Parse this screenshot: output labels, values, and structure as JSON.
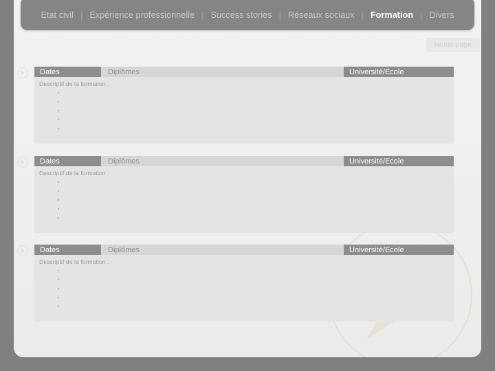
{
  "nav": {
    "separator": "|",
    "items": [
      {
        "label": "Etat civil",
        "active": false
      },
      {
        "label": "Expérience professionnelle",
        "active": false
      },
      {
        "label": "Success stories",
        "active": false
      },
      {
        "label": "Réseaux sociaux",
        "active": false
      },
      {
        "label": "Formation",
        "active": true
      },
      {
        "label": "Divers",
        "active": false
      }
    ]
  },
  "home_button": {
    "label": "Home page"
  },
  "columns": {
    "dates": "Dates",
    "diplomas": "Diplômes",
    "university": "Université/Ecole"
  },
  "description_label": "Descriptif de la formation :",
  "blocks": [
    {
      "dates": "Dates",
      "diplomas": "Diplômes",
      "university": "Université/Ecole",
      "description_label": "Descriptif de la formation :",
      "bullets": [
        "",
        "",
        "",
        "",
        ""
      ]
    },
    {
      "dates": "Dates",
      "diplomas": "Diplômes",
      "university": "Université/Ecole",
      "description_label": "Descriptif de la formation :",
      "bullets": [
        "",
        "",
        "",
        "",
        ""
      ]
    },
    {
      "dates": "Dates",
      "diplomas": "Diplômes",
      "university": "Université/Ecole",
      "description_label": "Descriptif de la formation :",
      "bullets": [
        "",
        "",
        "",
        "",
        ""
      ]
    }
  ],
  "icons": {
    "marker": "circle-arrow-icon",
    "watermark": "arrow-right-watermark"
  },
  "colors": {
    "page_background": "#808080",
    "card_background": "#f0f0f0",
    "navbar": "#858585",
    "nav_text": "#c9c9c9",
    "nav_active_text": "#ffffff",
    "header_dark": "#8d8d8d",
    "header_light": "#d6d6d6",
    "block_background": "#e4e4e4",
    "watermark": "#e6e2d5"
  }
}
